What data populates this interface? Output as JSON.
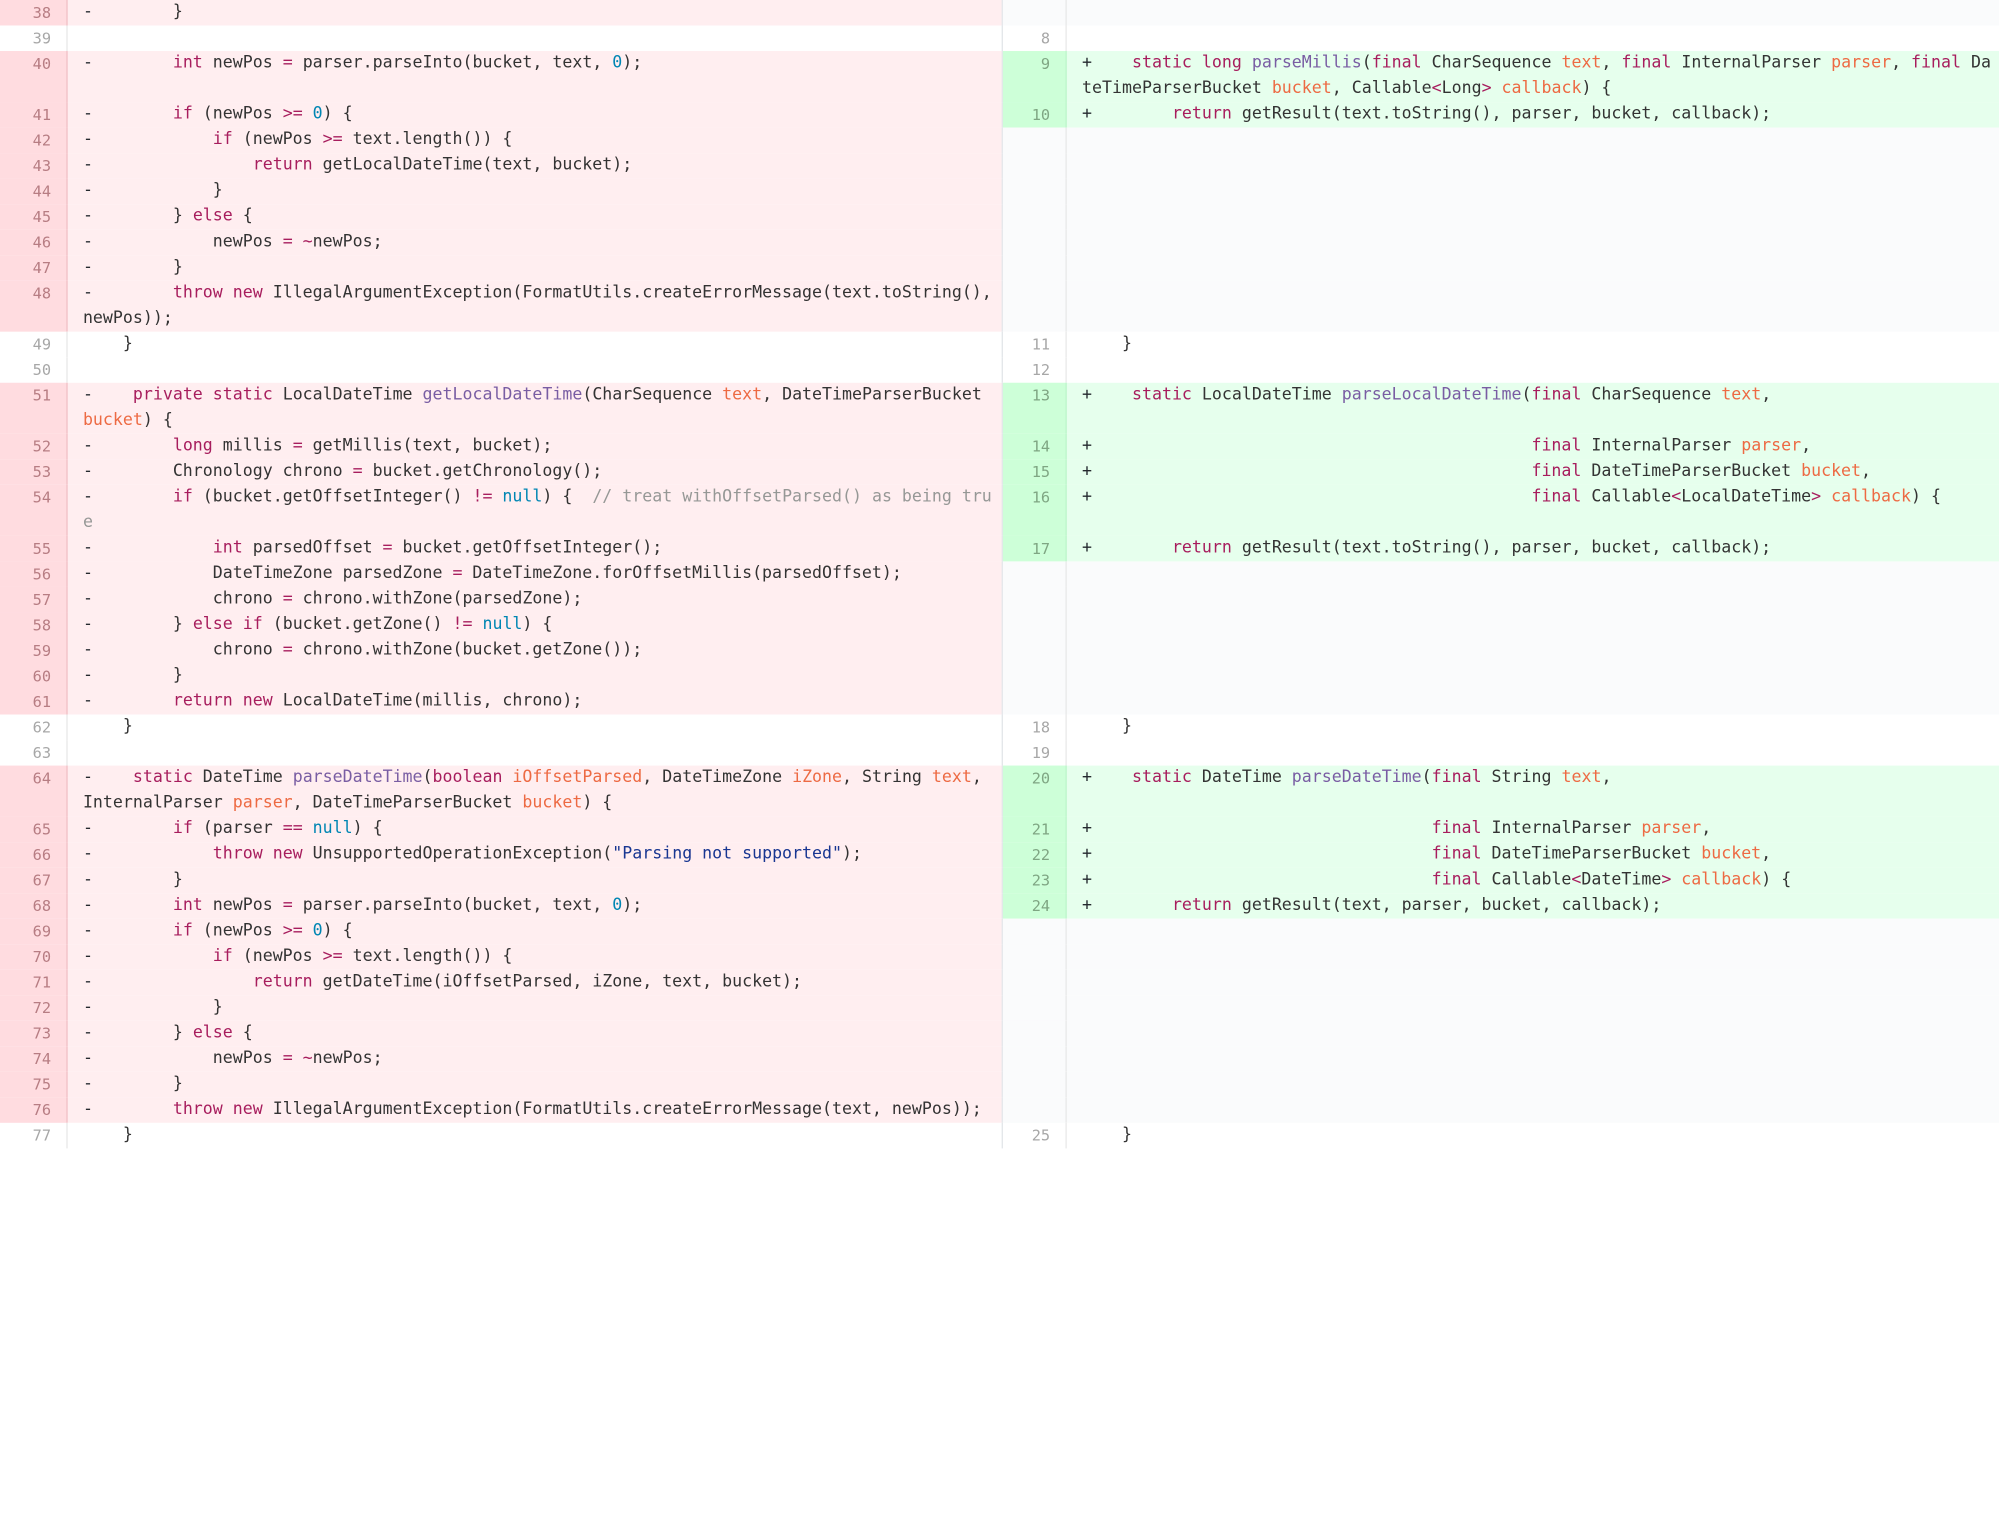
{
  "lines": [
    {
      "left": {
        "num": "38",
        "type": "del",
        "code": "-        }"
      },
      "right": {
        "num": "",
        "type": "empty",
        "code": ""
      }
    },
    {
      "left": {
        "num": "39",
        "type": "ctx",
        "code": ""
      },
      "right": {
        "num": "8",
        "type": "ctx",
        "code": ""
      }
    },
    {
      "left": {
        "num": "40",
        "type": "del",
        "code": "-        int newPos = parser.parseInto(bucket, text, 0);"
      },
      "right": {
        "num": "9",
        "type": "add",
        "code": "+    static long parseMillis(final CharSequence text, final InternalParser parser, final DateTimeParserBucket bucket, Callable<Long> callback) {"
      }
    },
    {
      "left": {
        "num": "41",
        "type": "del",
        "code": "-        if (newPos >= 0) {"
      },
      "right": {
        "num": "10",
        "type": "add",
        "code": "+        return getResult(text.toString(), parser, bucket, callback);"
      }
    },
    {
      "left": {
        "num": "42",
        "type": "del",
        "code": "-            if (newPos >= text.length()) {"
      },
      "right": {
        "num": "",
        "type": "empty",
        "code": ""
      }
    },
    {
      "left": {
        "num": "43",
        "type": "del",
        "code": "-                return getLocalDateTime(text, bucket);"
      },
      "right": {
        "num": "",
        "type": "empty",
        "code": ""
      }
    },
    {
      "left": {
        "num": "44",
        "type": "del",
        "code": "-            }"
      },
      "right": {
        "num": "",
        "type": "empty",
        "code": ""
      }
    },
    {
      "left": {
        "num": "45",
        "type": "del",
        "code": "-        } else {"
      },
      "right": {
        "num": "",
        "type": "empty",
        "code": ""
      }
    },
    {
      "left": {
        "num": "46",
        "type": "del",
        "code": "-            newPos = ~newPos;"
      },
      "right": {
        "num": "",
        "type": "empty",
        "code": ""
      }
    },
    {
      "left": {
        "num": "47",
        "type": "del",
        "code": "-        }"
      },
      "right": {
        "num": "",
        "type": "empty",
        "code": ""
      }
    },
    {
      "left": {
        "num": "48",
        "type": "del",
        "code": "-        throw new IllegalArgumentException(FormatUtils.createErrorMessage(text.toString(), newPos));"
      },
      "right": {
        "num": "",
        "type": "empty",
        "code": ""
      }
    },
    {
      "left": {
        "num": "49",
        "type": "ctx",
        "code": "    }"
      },
      "right": {
        "num": "11",
        "type": "ctx",
        "code": "    }"
      }
    },
    {
      "left": {
        "num": "50",
        "type": "ctx",
        "code": ""
      },
      "right": {
        "num": "12",
        "type": "ctx",
        "code": ""
      }
    },
    {
      "left": {
        "num": "51",
        "type": "del",
        "code": "-    private static LocalDateTime getLocalDateTime(CharSequence text, DateTimeParserBucket bucket) {"
      },
      "right": {
        "num": "13",
        "type": "add",
        "code": "+    static LocalDateTime parseLocalDateTime(final CharSequence text,"
      }
    },
    {
      "left": {
        "num": "52",
        "type": "del",
        "code": "-        long millis = getMillis(text, bucket);"
      },
      "right": {
        "num": "14",
        "type": "add",
        "code": "+                                            final InternalParser parser,"
      }
    },
    {
      "left": {
        "num": "53",
        "type": "del",
        "code": "-        Chronology chrono = bucket.getChronology();"
      },
      "right": {
        "num": "15",
        "type": "add",
        "code": "+                                            final DateTimeParserBucket bucket,"
      }
    },
    {
      "left": {
        "num": "54",
        "type": "del",
        "code": "-        if (bucket.getOffsetInteger() != null) {  // treat withOffsetParsed() as being true"
      },
      "right": {
        "num": "16",
        "type": "add",
        "code": "+                                            final Callable<LocalDateTime> callback) {"
      }
    },
    {
      "left": {
        "num": "55",
        "type": "del",
        "code": "-            int parsedOffset = bucket.getOffsetInteger();"
      },
      "right": {
        "num": "17",
        "type": "add",
        "code": "+        return getResult(text.toString(), parser, bucket, callback);"
      }
    },
    {
      "left": {
        "num": "56",
        "type": "del",
        "code": "-            DateTimeZone parsedZone = DateTimeZone.forOffsetMillis(parsedOffset);"
      },
      "right": {
        "num": "",
        "type": "empty",
        "code": ""
      }
    },
    {
      "left": {
        "num": "57",
        "type": "del",
        "code": "-            chrono = chrono.withZone(parsedZone);"
      },
      "right": {
        "num": "",
        "type": "empty",
        "code": ""
      }
    },
    {
      "left": {
        "num": "58",
        "type": "del",
        "code": "-        } else if (bucket.getZone() != null) {"
      },
      "right": {
        "num": "",
        "type": "empty",
        "code": ""
      }
    },
    {
      "left": {
        "num": "59",
        "type": "del",
        "code": "-            chrono = chrono.withZone(bucket.getZone());"
      },
      "right": {
        "num": "",
        "type": "empty",
        "code": ""
      }
    },
    {
      "left": {
        "num": "60",
        "type": "del",
        "code": "-        }"
      },
      "right": {
        "num": "",
        "type": "empty",
        "code": ""
      }
    },
    {
      "left": {
        "num": "61",
        "type": "del",
        "code": "-        return new LocalDateTime(millis, chrono);"
      },
      "right": {
        "num": "",
        "type": "empty",
        "code": ""
      }
    },
    {
      "left": {
        "num": "62",
        "type": "ctx",
        "code": "    }"
      },
      "right": {
        "num": "18",
        "type": "ctx",
        "code": "    }"
      }
    },
    {
      "left": {
        "num": "63",
        "type": "ctx",
        "code": ""
      },
      "right": {
        "num": "19",
        "type": "ctx",
        "code": ""
      }
    },
    {
      "left": {
        "num": "64",
        "type": "del",
        "code": "-    static DateTime parseDateTime(boolean iOffsetParsed, DateTimeZone iZone, String text, InternalParser parser, DateTimeParserBucket bucket) {"
      },
      "right": {
        "num": "20",
        "type": "add",
        "code": "+    static DateTime parseDateTime(final String text,"
      }
    },
    {
      "left": {
        "num": "65",
        "type": "del",
        "code": "-        if (parser == null) {"
      },
      "right": {
        "num": "21",
        "type": "add",
        "code": "+                                  final InternalParser parser,"
      }
    },
    {
      "left": {
        "num": "66",
        "type": "del",
        "code": "-            throw new UnsupportedOperationException(\"Parsing not supported\");"
      },
      "right": {
        "num": "22",
        "type": "add",
        "code": "+                                  final DateTimeParserBucket bucket,"
      }
    },
    {
      "left": {
        "num": "67",
        "type": "del",
        "code": "-        }"
      },
      "right": {
        "num": "23",
        "type": "add",
        "code": "+                                  final Callable<DateTime> callback) {"
      }
    },
    {
      "left": {
        "num": "68",
        "type": "del",
        "code": "-        int newPos = parser.parseInto(bucket, text, 0);"
      },
      "right": {
        "num": "24",
        "type": "add",
        "code": "+        return getResult(text, parser, bucket, callback);"
      }
    },
    {
      "left": {
        "num": "69",
        "type": "del",
        "code": "-        if (newPos >= 0) {"
      },
      "right": {
        "num": "",
        "type": "empty",
        "code": ""
      }
    },
    {
      "left": {
        "num": "70",
        "type": "del",
        "code": "-            if (newPos >= text.length()) {"
      },
      "right": {
        "num": "",
        "type": "empty",
        "code": ""
      }
    },
    {
      "left": {
        "num": "71",
        "type": "del",
        "code": "-                return getDateTime(iOffsetParsed, iZone, text, bucket);"
      },
      "right": {
        "num": "",
        "type": "empty",
        "code": ""
      }
    },
    {
      "left": {
        "num": "72",
        "type": "del",
        "code": "-            }"
      },
      "right": {
        "num": "",
        "type": "empty",
        "code": ""
      }
    },
    {
      "left": {
        "num": "73",
        "type": "del",
        "code": "-        } else {"
      },
      "right": {
        "num": "",
        "type": "empty",
        "code": ""
      }
    },
    {
      "left": {
        "num": "74",
        "type": "del",
        "code": "-            newPos = ~newPos;"
      },
      "right": {
        "num": "",
        "type": "empty",
        "code": ""
      }
    },
    {
      "left": {
        "num": "75",
        "type": "del",
        "code": "-        }"
      },
      "right": {
        "num": "",
        "type": "empty",
        "code": ""
      }
    },
    {
      "left": {
        "num": "76",
        "type": "del",
        "code": "-        throw new IllegalArgumentException(FormatUtils.createErrorMessage(text, newPos));"
      },
      "right": {
        "num": "",
        "type": "empty",
        "code": ""
      }
    },
    {
      "left": {
        "num": "77",
        "type": "ctx",
        "code": "    }"
      },
      "right": {
        "num": "25",
        "type": "ctx",
        "code": "    }"
      }
    }
  ]
}
